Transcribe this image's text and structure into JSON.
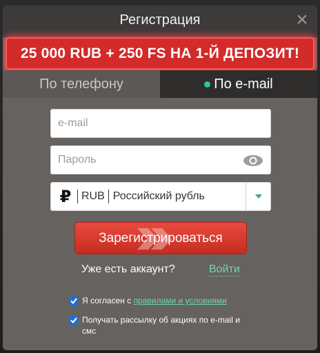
{
  "header": {
    "title": "Регистрация",
    "close_label": "×"
  },
  "promo": {
    "text": "25 000 RUB + 250 FS НА 1-Й ДЕПОЗИТ!"
  },
  "tabs": [
    {
      "label": "По телефону",
      "active": false
    },
    {
      "label": "По e-mail",
      "active": true
    }
  ],
  "form": {
    "email": {
      "placeholder": "e-mail",
      "value": ""
    },
    "password": {
      "placeholder": "Пароль",
      "value": ""
    },
    "currency": {
      "symbol": "₽",
      "code": "RUB",
      "name": "Российский рубль"
    }
  },
  "register_button": {
    "label": "Зарегистрироваться"
  },
  "login": {
    "prompt": "Уже есть аккаунт?",
    "link": "Войти"
  },
  "agreements": {
    "terms_prefix": "Я согласен с",
    "terms_link": "правилами и условиями",
    "newsletter": "Получать рассылку об акциях по e-mail и смс"
  },
  "colors": {
    "accent": "#2ec4a0",
    "promo_red": "#d32a2a",
    "button_red": "#d63a2e",
    "checkbox_blue": "#1e6fd9"
  }
}
